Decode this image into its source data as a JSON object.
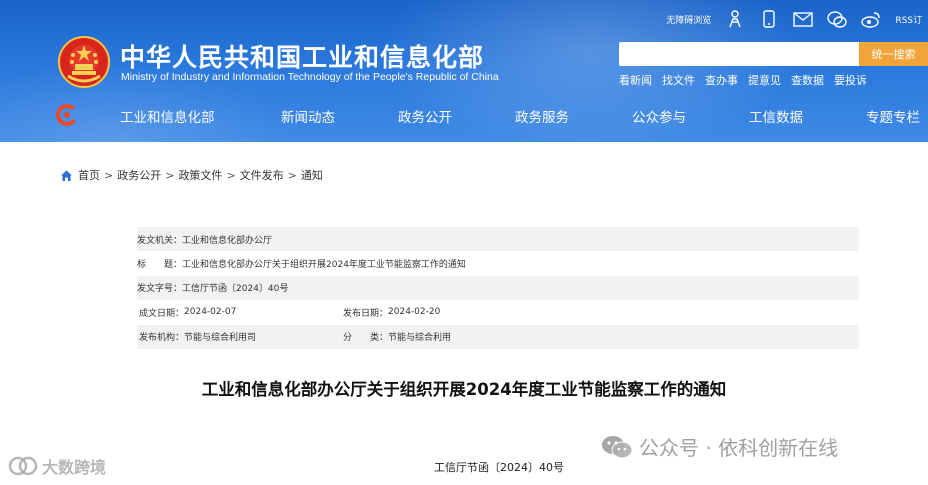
{
  "header": {
    "title": "中华人民共和国工业和信息化部",
    "subtitle": "Ministry of Industry and Information Technology of the People's Republic of China",
    "tools": {
      "accessibility_label": "无障碍浏览",
      "rss_label": "RSS订",
      "icons": [
        "accessibility-icon",
        "elder-mode-icon",
        "mobile-icon",
        "mail-icon",
        "wechat-icon",
        "weibo-icon"
      ]
    },
    "search": {
      "placeholder": "",
      "button_label": "统一搜索"
    },
    "quick_links": [
      "看新闻",
      "找文件",
      "查办事",
      "提意见",
      "查数据",
      "要投诉"
    ],
    "nav": [
      "工业和信息化部",
      "新闻动态",
      "政务公开",
      "政务服务",
      "公众参与",
      "工信数据",
      "专题专栏"
    ]
  },
  "breadcrumb": [
    "首页",
    "政务公开",
    "政策文件",
    "文件发布",
    "通知"
  ],
  "info": {
    "issuer_label": "发文机关：",
    "issuer": "工业和信息化部办公厅",
    "title_label": "标　　题：",
    "title": "工业和信息化部办公厅关于组织开展2024年度工业节能监察工作的通知",
    "doc_number_label": "发文字号：",
    "doc_number": "工信厅节函〔2024〕40号",
    "written_date_label": "成文日期：",
    "written_date": "2024-02-07",
    "publish_date_label": "发布日期：",
    "publish_date": "2024-02-20",
    "agency_label": "发布机构：",
    "agency": "节能与综合利用司",
    "category_label": "分　　类：",
    "category": "节能与综合利用"
  },
  "article": {
    "title": "工业和信息化部办公厅关于组织开展2024年度工业节能监察工作的通知",
    "doc_number": "工信厅节函〔2024〕40号"
  },
  "watermarks": {
    "left": "大数跨境",
    "right": "公众号 · 依科创新在线"
  },
  "colors": {
    "header_blue": "#2a78dc",
    "search_button": "#f2a43a",
    "row_shade": "#f2f2f2"
  }
}
